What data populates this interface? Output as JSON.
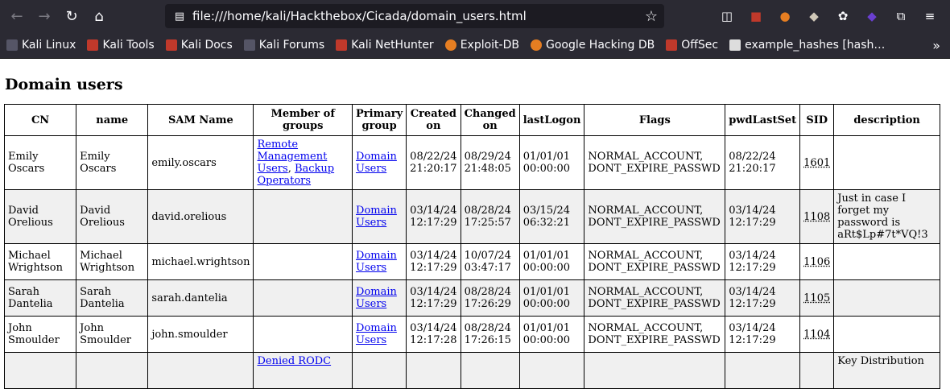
{
  "browser": {
    "url": "file:///home/kali/Hackthebox/Cicada/domain_users.html",
    "bookmarks": [
      "Kali Linux",
      "Kali Tools",
      "Kali Docs",
      "Kali Forums",
      "Kali NetHunter",
      "Exploit-DB",
      "Google Hacking DB",
      "OffSec",
      "example_hashes [hash…"
    ]
  },
  "page": {
    "title": "Domain users",
    "headers": [
      "CN",
      "name",
      "SAM Name",
      "Member of groups",
      "Primary group",
      "Created on",
      "Changed on",
      "lastLogon",
      "Flags",
      "pwdLastSet",
      "SID",
      "description"
    ],
    "rows": [
      {
        "cn": "Emily Oscars",
        "name": "Emily Oscars",
        "sam": "emily.oscars",
        "groups": [
          "Remote Management Users",
          "Backup Operators"
        ],
        "primary": "Domain Users",
        "created": "08/22/24 21:20:17",
        "changed": "08/29/24 21:48:05",
        "lastlogon": "01/01/01 00:00:00",
        "flags": "NORMAL_ACCOUNT, DONT_EXPIRE_PASSWD",
        "pwdlastset": "08/22/24 21:20:17",
        "sid": "1601",
        "description": ""
      },
      {
        "cn": "David Orelious",
        "name": "David Orelious",
        "sam": "david.orelious",
        "groups": [],
        "primary": "Domain Users",
        "created": "03/14/24 12:17:29",
        "changed": "08/28/24 17:25:57",
        "lastlogon": "03/15/24 06:32:21",
        "flags": "NORMAL_ACCOUNT, DONT_EXPIRE_PASSWD",
        "pwdlastset": "03/14/24 12:17:29",
        "sid": "1108",
        "description": "Just in case I forget my password is aRt$Lp#7t*VQ!3"
      },
      {
        "cn": "Michael Wrightson",
        "name": "Michael Wrightson",
        "sam": "michael.wrightson",
        "groups": [],
        "primary": "Domain Users",
        "created": "03/14/24 12:17:29",
        "changed": "10/07/24 03:47:17",
        "lastlogon": "01/01/01 00:00:00",
        "flags": "NORMAL_ACCOUNT, DONT_EXPIRE_PASSWD",
        "pwdlastset": "03/14/24 12:17:29",
        "sid": "1106",
        "description": ""
      },
      {
        "cn": "Sarah Dantelia",
        "name": "Sarah Dantelia",
        "sam": "sarah.dantelia",
        "groups": [],
        "primary": "Domain Users",
        "created": "03/14/24 12:17:29",
        "changed": "08/28/24 17:26:29",
        "lastlogon": "01/01/01 00:00:00",
        "flags": "NORMAL_ACCOUNT, DONT_EXPIRE_PASSWD",
        "pwdlastset": "03/14/24 12:17:29",
        "sid": "1105",
        "description": ""
      },
      {
        "cn": "John Smoulder",
        "name": "John Smoulder",
        "sam": "john.smoulder",
        "groups": [],
        "primary": "Domain Users",
        "created": "03/14/24 12:17:28",
        "changed": "08/28/24 17:26:15",
        "lastlogon": "01/01/01 00:00:00",
        "flags": "NORMAL_ACCOUNT, DONT_EXPIRE_PASSWD",
        "pwdlastset": "03/14/24 12:17:29",
        "sid": "1104",
        "description": ""
      },
      {
        "cn": "",
        "name": "",
        "sam": "",
        "groups": [
          "Denied RODC"
        ],
        "primary": "",
        "created": "",
        "changed": "",
        "lastlogon": "",
        "flags": "",
        "pwdlastset": "",
        "sid": "",
        "description": "Key Distribution"
      }
    ]
  },
  "colors": {
    "chrome": "#2b2a33",
    "urlbar": "#1c1b22",
    "link": "#0000ee",
    "shade": "#f0f0f0"
  }
}
